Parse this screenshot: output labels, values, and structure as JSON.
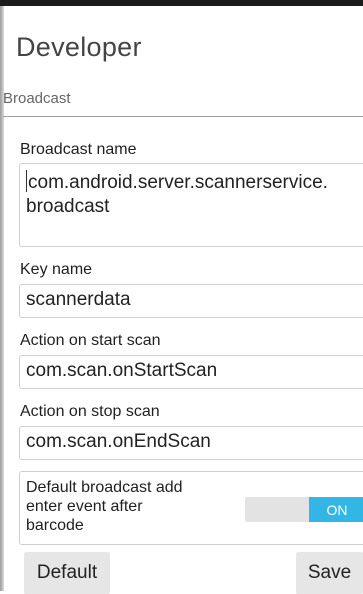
{
  "dialog": {
    "title": "Developer"
  },
  "section": {
    "title": "Broadcast"
  },
  "fields": {
    "broadcast_name": {
      "label": "Broadcast name",
      "value_line1": "com.android.server.scannerservice.",
      "value_line2": "broadcast"
    },
    "key_name": {
      "label": "Key name",
      "value": "scannerdata"
    },
    "action_start": {
      "label": "Action on start scan",
      "value": "com.scan.onStartScan"
    },
    "action_stop": {
      "label": "Action on stop scan",
      "value": "com.scan.onEndScan"
    }
  },
  "toggle": {
    "label_line1": "Default broadcast add",
    "label_line2": "enter event after",
    "label_line3": "barcode",
    "state_label": "ON"
  },
  "buttons": {
    "default_label": "Default",
    "save_label": "Save"
  },
  "colors": {
    "accent": "#33b5e5",
    "toggle_track": "#e3e3e3",
    "button_bg": "#e6e6e6"
  }
}
